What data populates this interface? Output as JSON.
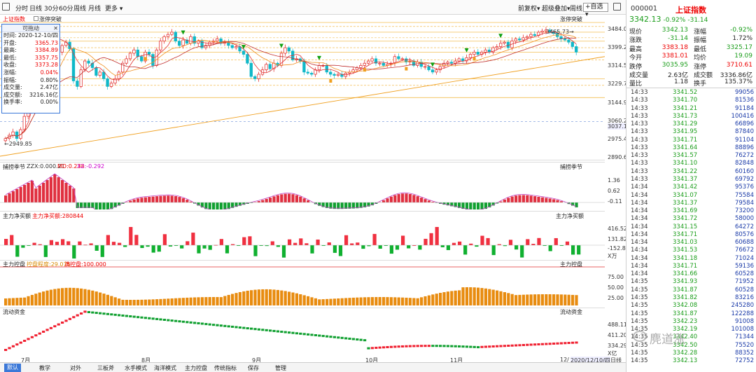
{
  "toolbar": {
    "period_tabs": [
      "分时",
      "日线",
      "30分",
      "60分",
      "周线",
      "月线",
      "更多"
    ],
    "right_buttons": [
      "前复权",
      "超级叠加",
      "周线"
    ],
    "search_value": "+自选"
  },
  "main_chart": {
    "title": "上证指数",
    "subtitle": "涨停突破",
    "right_title": "涨停突破",
    "high_label": "3465.73",
    "low_label": "2949.85",
    "price_levels": [
      "3484.04",
      "3399.28",
      "3314.51",
      "3229.75",
      "3144.98",
      "3060.22",
      "3037.19",
      "2975.45",
      "2890.69"
    ],
    "closes": [
      2960,
      2975,
      2990,
      2960,
      3000,
      3060,
      3150,
      3280,
      3340,
      3380,
      3420,
      3435,
      3445,
      3410,
      3350,
      3380,
      3395,
      3365,
      3220,
      3195,
      3270,
      3310,
      3300,
      3280,
      3245,
      3260,
      3230,
      3195,
      3210,
      3230,
      3260,
      3300,
      3320,
      3345,
      3360,
      3330,
      3310,
      3350,
      3340,
      3290,
      3360,
      3400,
      3420,
      3430,
      3440,
      3400,
      3380,
      3405,
      3390,
      3420,
      3390,
      3400,
      3370,
      3380,
      3395,
      3400,
      3410,
      3390,
      3395,
      3380,
      3370,
      3375,
      3355,
      3340,
      3300,
      3240,
      3230,
      3250,
      3270,
      3295,
      3275,
      3300,
      3290,
      3345,
      3370,
      3355,
      3315,
      3320,
      3310,
      3260,
      3255,
      3250,
      3270,
      3290,
      3290,
      3260,
      3250,
      3245,
      3250,
      3240,
      3255,
      3260,
      3270,
      3280,
      3290,
      3300,
      3310,
      3320,
      3300,
      3300,
      3290,
      3295,
      3300,
      3330,
      3320,
      3320,
      3305,
      3310,
      3290,
      3305,
      3285,
      3285,
      3270,
      3260,
      3270,
      3285,
      3300,
      3305,
      3300,
      3310,
      3320,
      3310,
      3325,
      3340,
      3350,
      3340,
      3350,
      3360,
      3350,
      3370,
      3375,
      3390,
      3395,
      3370,
      3400,
      3410,
      3405,
      3415,
      3420,
      3430,
      3425,
      3440,
      3445,
      3450,
      3440,
      3435,
      3420,
      3410,
      3405,
      3395,
      3375,
      3350
    ],
    "down_marks": [
      14,
      47,
      63,
      73,
      83,
      113,
      122,
      131
    ],
    "up_marks": [
      37,
      86,
      95,
      106,
      124
    ]
  },
  "info_box": {
    "title": "可拖动",
    "rows": [
      {
        "k": "时间:",
        "v": "2020-12-10/四"
      },
      {
        "k": "开盘:",
        "v": "3365.73"
      },
      {
        "k": "最高:",
        "v": "3384.89"
      },
      {
        "k": "最低:",
        "v": "3357.75"
      },
      {
        "k": "收盘:",
        "v": "3373.28"
      },
      {
        "k": "涨幅:",
        "v": "0.04%"
      },
      {
        "k": "振幅:",
        "v": "0.80%"
      },
      {
        "k": "成交量:",
        "v": "2.47亿"
      },
      {
        "k": "成交额:",
        "v": "3216.16亿"
      },
      {
        "k": "换手率:",
        "v": "0.00%"
      }
    ]
  },
  "panel2": {
    "title": "捕捞季节",
    "legend": [
      "ZZX:0.000.21",
      "MD:0.238",
      "X2:-0.292"
    ],
    "right_title": "捕捞季节",
    "labels": [
      "1.36",
      "0.62",
      "-0.11"
    ]
  },
  "panel3": {
    "title": "主力净买额",
    "legend": "主力净买额:280844",
    "right_title": "主力净买额",
    "labels": [
      "416.52",
      "131.82",
      "-152.89",
      "X万"
    ]
  },
  "panel4": {
    "title": "主力控盘",
    "legend": [
      "控盘程度:29.075",
      "满控盘:100.000"
    ],
    "right_title": "主力控盘",
    "labels": [
      "75.00",
      "50.00",
      "25.00"
    ]
  },
  "panel5": {
    "title": "流动资金",
    "right_title": "流动资金",
    "labels": [
      "488.11",
      "411.20",
      "334.29",
      "X亿"
    ]
  },
  "x_axis": {
    "labels": [
      "7月",
      "8月",
      "9月",
      "10月",
      "11月",
      "12/",
      "2020/12/10/四"
    ],
    "right_label": "日线"
  },
  "bottom_tabs": [
    "默认",
    "教学",
    "对外",
    "三板斧",
    "水手模式",
    "海洋模式",
    "主力控盘",
    "传统指标",
    "保存",
    "管理"
  ],
  "quote": {
    "code": "000001",
    "name": "上证指数",
    "price": "3342.13",
    "change_pct": "-0.92%",
    "change": "-31.14",
    "rows": [
      {
        "k": "现价",
        "v": "3342.13",
        "k2": "涨幅",
        "v2": "-0.92%",
        "c1": "#1a9d1a",
        "c2": "#1a9d1a"
      },
      {
        "k": "涨跌",
        "v": "-31.14",
        "k2": "振幅",
        "v2": "1.72%",
        "c1": "#1a9d1a",
        "c2": "#222"
      },
      {
        "k": "最高",
        "v": "3383.18",
        "k2": "最低",
        "v2": "3325.17",
        "c1": "#e00",
        "c2": "#1a9d1a"
      },
      {
        "k": "今开",
        "v": "3381.01",
        "k2": "均价",
        "v2": "19.09",
        "c1": "#e00",
        "c2": "#1a9d1a"
      },
      {
        "k": "跌停",
        "v": "3035.95",
        "k2": "涨停",
        "v2": "3710.61",
        "c1": "#1a9d1a",
        "c2": "#e00"
      },
      {
        "k": "成交量",
        "v": "2.63亿",
        "k2": "成交额",
        "v2": "3336.86亿",
        "c1": "#222",
        "c2": "#222"
      },
      {
        "k": "量比",
        "v": "1.18",
        "k2": "换手",
        "v2": "135.37%",
        "c1": "#222",
        "c2": "#222"
      }
    ],
    "ticks": [
      {
        "t": "14:33",
        "p": "3341.52",
        "v": "99056"
      },
      {
        "t": "14:33",
        "p": "3341.70",
        "v": "81536"
      },
      {
        "t": "14:33",
        "p": "3341.21",
        "v": "91184"
      },
      {
        "t": "14:33",
        "p": "3341.73",
        "v": "100416"
      },
      {
        "t": "14:33",
        "p": "3341.29",
        "v": "66896"
      },
      {
        "t": "14:33",
        "p": "3341.95",
        "v": "87840"
      },
      {
        "t": "14:33",
        "p": "3341.71",
        "v": "91104"
      },
      {
        "t": "14:33",
        "p": "3341.64",
        "v": "88896"
      },
      {
        "t": "14:33",
        "p": "3341.57",
        "v": "76272"
      },
      {
        "t": "14:33",
        "p": "3341.10",
        "v": "82848"
      },
      {
        "t": "14:33",
        "p": "3341.22",
        "v": "60160"
      },
      {
        "t": "14:33",
        "p": "3341.37",
        "v": "69792"
      },
      {
        "t": "14:34",
        "p": "3341.42",
        "v": "95376"
      },
      {
        "t": "14:34",
        "p": "3341.07",
        "v": "75584"
      },
      {
        "t": "14:34",
        "p": "3341.37",
        "v": "79584"
      },
      {
        "t": "14:34",
        "p": "3341.69",
        "v": "73200"
      },
      {
        "t": "14:34",
        "p": "3341.72",
        "v": "58000"
      },
      {
        "t": "14:34",
        "p": "3341.15",
        "v": "64272"
      },
      {
        "t": "14:34",
        "p": "3341.71",
        "v": "80576"
      },
      {
        "t": "14:34",
        "p": "3341.03",
        "v": "60688"
      },
      {
        "t": "14:34",
        "p": "3341.53",
        "v": "76672"
      },
      {
        "t": "14:34",
        "p": "3341.18",
        "v": "71024"
      },
      {
        "t": "14:34",
        "p": "3341.71",
        "v": "59136"
      },
      {
        "t": "14:34",
        "p": "3341.66",
        "v": "60528"
      },
      {
        "t": "14:35",
        "p": "3341.93",
        "v": "71952"
      },
      {
        "t": "14:35",
        "p": "3341.87",
        "v": "60528"
      },
      {
        "t": "14:35",
        "p": "3341.82",
        "v": "83216"
      },
      {
        "t": "14:35",
        "p": "3342.08",
        "v": "245280"
      },
      {
        "t": "14:35",
        "p": "3341.87",
        "v": "122288"
      },
      {
        "t": "14:35",
        "p": "3342.23",
        "v": "91008"
      },
      {
        "t": "14:35",
        "p": "3342.19",
        "v": "101008"
      },
      {
        "t": "14:35",
        "p": "3342.40",
        "v": "71344"
      },
      {
        "t": "14:35",
        "p": "3342.50",
        "v": "75520"
      },
      {
        "t": "14:35",
        "p": "3342.28",
        "v": "88352"
      },
      {
        "t": "14:35",
        "p": "3342.13",
        "v": "72752"
      }
    ]
  },
  "watermark": "麂道涨"
}
